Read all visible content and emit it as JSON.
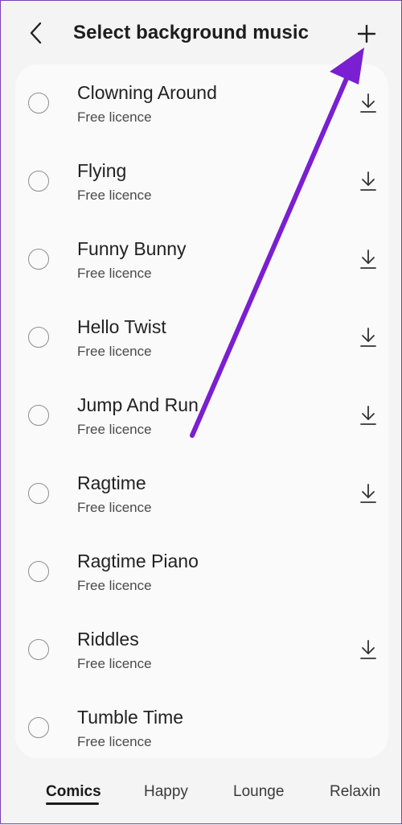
{
  "header": {
    "title": "Select background music",
    "back_icon": "chevron-left-icon",
    "add_icon": "plus-icon"
  },
  "tracks": [
    {
      "name": "Clowning Around",
      "license": "Free licence",
      "downloadable": true
    },
    {
      "name": "Flying",
      "license": "Free licence",
      "downloadable": true
    },
    {
      "name": "Funny Bunny",
      "license": "Free licence",
      "downloadable": true
    },
    {
      "name": "Hello Twist",
      "license": "Free licence",
      "downloadable": true
    },
    {
      "name": "Jump And Run",
      "license": "Free licence",
      "downloadable": true
    },
    {
      "name": "Ragtime",
      "license": "Free licence",
      "downloadable": true
    },
    {
      "name": "Ragtime Piano",
      "license": "Free licence",
      "downloadable": false
    },
    {
      "name": "Riddles",
      "license": "Free licence",
      "downloadable": true
    },
    {
      "name": "Tumble Time",
      "license": "Free licence",
      "downloadable": false
    }
  ],
  "tabs": [
    {
      "label": "Comics",
      "active": true
    },
    {
      "label": "Happy",
      "active": false
    },
    {
      "label": "Lounge",
      "active": false
    },
    {
      "label": "Relaxin",
      "active": false
    }
  ],
  "colors": {
    "annotation_arrow": "#7a1fd1"
  }
}
